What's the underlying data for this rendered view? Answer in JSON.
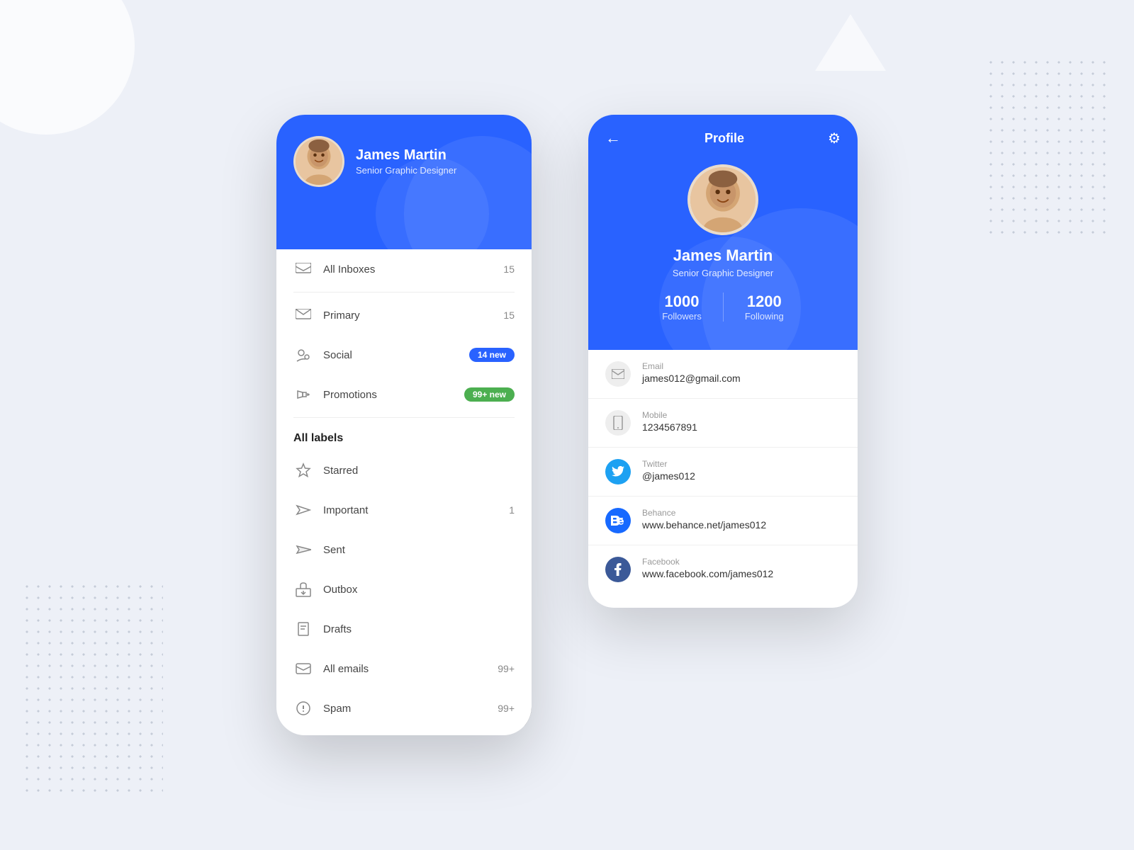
{
  "background": {
    "color": "#edf0f7"
  },
  "leftPhone": {
    "header": {
      "name": "James Martin",
      "role": "Senior Graphic Designer"
    },
    "menu": {
      "allInboxes": {
        "label": "All Inboxes",
        "count": "15"
      },
      "primary": {
        "label": "Primary",
        "count": "15"
      },
      "social": {
        "label": "Social",
        "badge": "14 new",
        "badgeType": "blue"
      },
      "promotions": {
        "label": "Promotions",
        "badge": "99+ new",
        "badgeType": "green"
      }
    },
    "allLabels": {
      "title": "All labels",
      "items": [
        {
          "label": "Starred",
          "count": ""
        },
        {
          "label": "Important",
          "count": "1"
        },
        {
          "label": "Sent",
          "count": ""
        },
        {
          "label": "Outbox",
          "count": ""
        },
        {
          "label": "Drafts",
          "count": ""
        },
        {
          "label": "All emails",
          "count": "99+"
        },
        {
          "label": "Spam",
          "count": "99+"
        }
      ]
    }
  },
  "rightPhone": {
    "topbar": {
      "title": "Profile",
      "backLabel": "←",
      "settingsLabel": "⚙"
    },
    "profile": {
      "name": "James Martin",
      "role": "Senior Graphic Designer",
      "followers": {
        "count": "1000",
        "label": "Followers"
      },
      "following": {
        "count": "1200",
        "label": "Following"
      }
    },
    "contacts": [
      {
        "type": "email",
        "label": "Email",
        "value": "james012@gmail.com"
      },
      {
        "type": "mobile",
        "label": "Mobile",
        "value": "1234567891"
      },
      {
        "type": "twitter",
        "label": "Twitter",
        "value": "@james012"
      },
      {
        "type": "behance",
        "label": "Behance",
        "value": "www.behance.net/james012"
      },
      {
        "type": "facebook",
        "label": "Facebook",
        "value": "www.facebook.com/james012"
      }
    ]
  }
}
